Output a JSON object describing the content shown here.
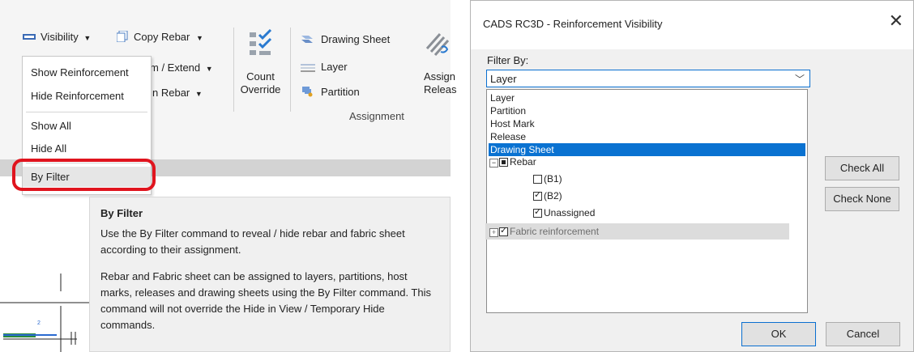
{
  "ribbon": {
    "visibility_label": "Visibility",
    "copy_rebar_label": "Copy Rebar",
    "trim_extend_label": "m / Extend",
    "rebar_label": "n Rebar",
    "count_override": [
      "Count",
      "Override"
    ],
    "assignment_items": [
      "Drawing Sheet",
      "Layer",
      "Partition"
    ],
    "assign_release": [
      "Assign",
      "Releas"
    ],
    "assignment_label": "Assignment"
  },
  "menu": {
    "items": [
      "Show Reinforcement",
      "Hide Reinforcement",
      "Show All",
      "Hide All",
      "By Filter"
    ]
  },
  "tooltip": {
    "title": "By Filter",
    "paragraph1": "Use the By Filter command to reveal / hide rebar and fabric sheet according to their assignment.",
    "paragraph2": "Rebar and Fabric sheet can be assigned to layers, partitions, host marks, releases and drawing sheets using the By Filter command. This command will not override the Hide in View / Temporary Hide commands."
  },
  "dialog": {
    "title": "CADS RC3D - Reinforcement Visibility",
    "filter_by_label": "Filter By:",
    "combo_value": "Layer",
    "options": [
      "Layer",
      "Partition",
      "Host Mark",
      "Release",
      "Drawing Sheet"
    ],
    "highlighted_option": "Drawing Sheet",
    "tree": {
      "rebar_label": "Rebar",
      "items": [
        {
          "label": "(B1)",
          "checked": false
        },
        {
          "label": "(B2)",
          "checked": true
        },
        {
          "label": "Unassigned",
          "checked": true
        }
      ],
      "fabric_label": "Fabric reinforcement"
    },
    "buttons": {
      "check_all": "Check All",
      "check_none": "Check None",
      "ok": "OK",
      "cancel": "Cancel"
    }
  }
}
